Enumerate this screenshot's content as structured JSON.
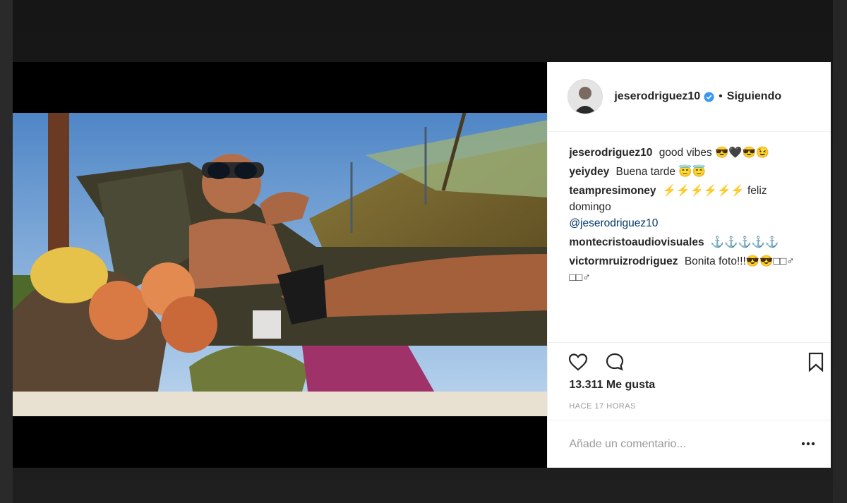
{
  "post": {
    "author": {
      "username": "jeserodriguez10",
      "verified": true,
      "avatar_icon": "profile-avatar"
    },
    "separator": "•",
    "follow_status": "Siguiendo",
    "comments": [
      {
        "user": "jeserodriguez10",
        "text": "good vibes 😎🖤😎😉"
      },
      {
        "user": "yeiydey",
        "text": "Buena tarde 😇😇"
      },
      {
        "user": "teampresimoney",
        "text": "⚡⚡⚡⚡⚡⚡ feliz domingo",
        "mention": "@jeserodriguez10"
      },
      {
        "user": "montecristoaudiovisuales",
        "text": "⚓⚓⚓⚓⚓"
      },
      {
        "user": "victormruizrodriguez",
        "text": "Bonita foto!!!😎😎□□♂ □□♂"
      }
    ],
    "likes_label": "13.311 Me gusta",
    "time_label": "HACE 17 HORAS",
    "add_comment_placeholder": "Añade un comentario...",
    "icons": {
      "like": "heart-icon",
      "comment": "comment-bubble-icon",
      "save": "bookmark-icon",
      "more": "more-options-icon"
    }
  }
}
